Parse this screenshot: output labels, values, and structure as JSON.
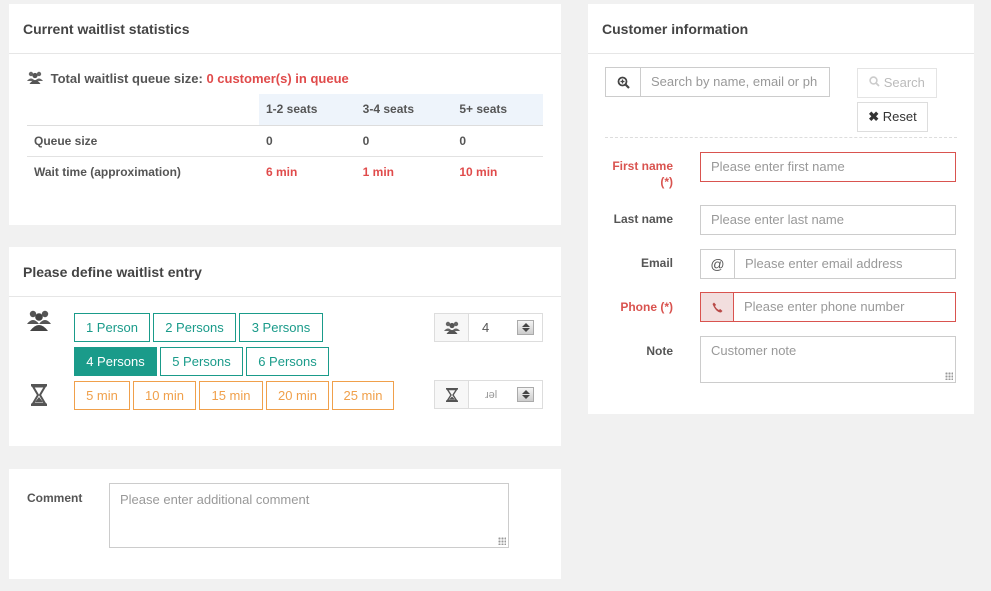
{
  "stats": {
    "title": "Current waitlist statistics",
    "total_label": "Total waitlist queue size:",
    "total_value": "0 customer(s) in queue",
    "columns": [
      "1-2 seats",
      "3-4 seats",
      "5+ seats"
    ],
    "rows": [
      {
        "label": "Queue size",
        "values": [
          "0",
          "0",
          "0"
        ]
      },
      {
        "label": "Wait time (approximation)",
        "values": [
          "6 min",
          "1 min",
          "10 min"
        ]
      }
    ]
  },
  "entry": {
    "title": "Please define waitlist entry",
    "persons": [
      "1 Person",
      "2 Persons",
      "3 Persons",
      "4 Persons",
      "5 Persons",
      "6 Persons"
    ],
    "selected_persons": "4 Persons",
    "times": [
      "5 min",
      "10 min",
      "15 min",
      "20 min",
      "25 min"
    ],
    "persons_value": "4",
    "time_placeholder": "ɹǝl"
  },
  "comment": {
    "label": "Comment",
    "placeholder": "Please enter additional comment"
  },
  "customer": {
    "title": "Customer information",
    "search_placeholder": "Search by name, email or ph",
    "search_button": "Search",
    "reset_button": "Reset",
    "first_name_label": "First name",
    "required_mark": "(*)",
    "first_name_placeholder": "Please enter first name",
    "last_name_label": "Last name",
    "last_name_placeholder": "Please enter last name",
    "email_label": "Email",
    "email_addon": "@",
    "email_placeholder": "Please enter email address",
    "phone_label": "Phone (*)",
    "phone_placeholder": "Please enter phone number",
    "note_label": "Note",
    "note_placeholder": "Customer note"
  },
  "colors": {
    "accent": "#1a9b8a",
    "warning": "#f0a04b",
    "danger": "#e04b4b"
  }
}
